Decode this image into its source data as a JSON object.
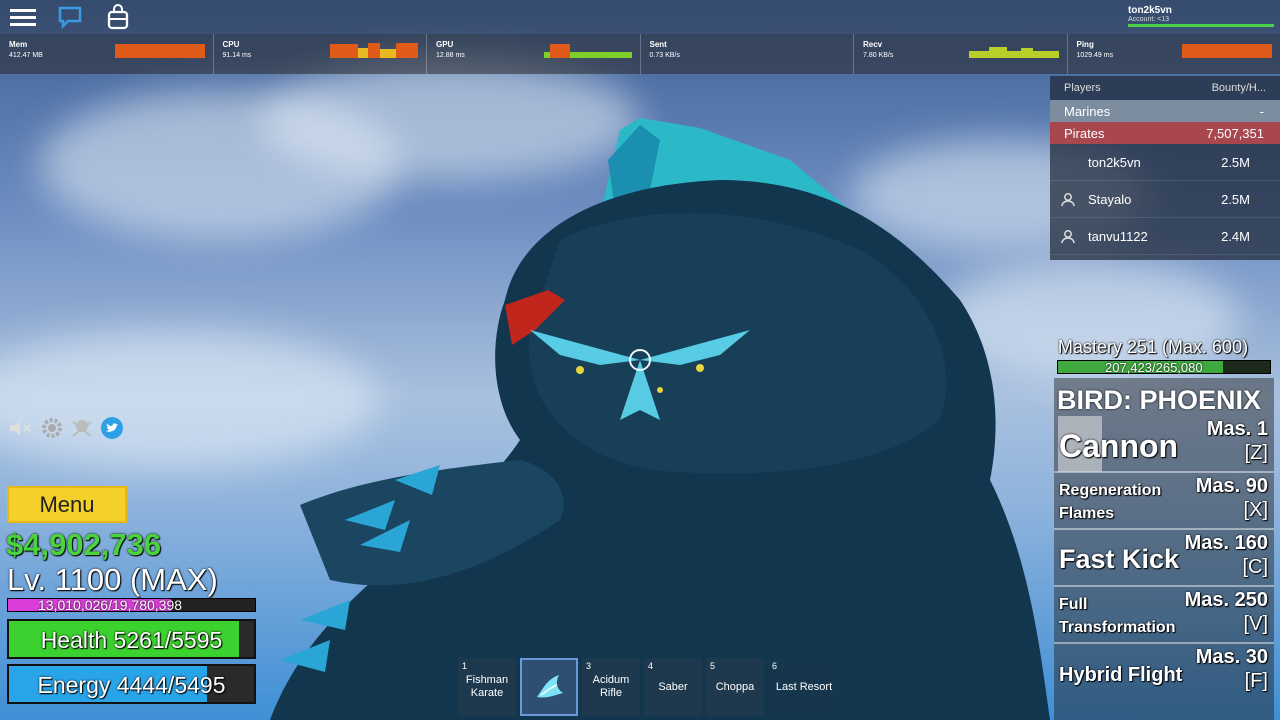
{
  "topbar": {
    "account_name": "ton2k5vn",
    "account_sub": "Account: <13"
  },
  "stats": [
    {
      "label": "Mem",
      "value": "412.47 MB"
    },
    {
      "label": "CPU",
      "value": "91.14 ms"
    },
    {
      "label": "GPU",
      "value": "12.88 ms"
    },
    {
      "label": "Sent",
      "value": "0.73 KB/s"
    },
    {
      "label": "Recv",
      "value": "7.80 KB/s"
    },
    {
      "label": "Ping",
      "value": "1029.49 ms"
    }
  ],
  "players": {
    "col_players": "Players",
    "col_bounty": "Bounty/H...",
    "marines": {
      "label": "Marines",
      "value": "-"
    },
    "pirates": {
      "label": "Pirates",
      "value": "7,507,351"
    },
    "list": [
      {
        "name": "ton2k5vn",
        "bounty": "2.5M"
      },
      {
        "name": "Stayalo",
        "bounty": "2.5M"
      },
      {
        "name": "tanvu1122",
        "bounty": "2.4M"
      }
    ]
  },
  "hud": {
    "menu_label": "Menu",
    "money": "$4,902,736",
    "level": "Lv. 1100 (MAX)",
    "xp_text": "13,010,026/19,780,398",
    "xp_fraction": 0.658,
    "health_text": "Health 5261/5595",
    "health_fraction": 0.94,
    "energy_text": "Energy 4444/5495",
    "energy_fraction": 0.81
  },
  "hotbar": [
    {
      "num": "1",
      "label": "Fishman Karate"
    },
    {
      "num": "",
      "label": ""
    },
    {
      "num": "3",
      "label": "Acidum Rifle"
    },
    {
      "num": "4",
      "label": "Saber"
    },
    {
      "num": "5",
      "label": "Choppa"
    },
    {
      "num": "6",
      "label": "Last Resort"
    }
  ],
  "mastery": {
    "title": "Mastery 251 (Max. 600)",
    "progress_text": "207,423/265,080",
    "fraction": 0.78
  },
  "fruit": {
    "name": "BIRD: PHOENIX",
    "skills": [
      {
        "name": "Cannon",
        "mas": "Mas. 1",
        "key": "[Z]"
      },
      {
        "name": "Regeneration Flames",
        "mas": "Mas. 90",
        "key": "[X]"
      },
      {
        "name": "Fast Kick",
        "mas": "Mas. 160",
        "key": "[C]"
      },
      {
        "name": "Full Transformation",
        "mas": "Mas. 250",
        "key": "[V]"
      },
      {
        "name": "Hybrid Flight",
        "mas": "Mas. 30",
        "key": "[F]"
      }
    ]
  },
  "colors": {
    "health": "#3bd12e",
    "energy": "#29a4e8",
    "xp": "#d93ed9",
    "money": "#4ad33e"
  }
}
